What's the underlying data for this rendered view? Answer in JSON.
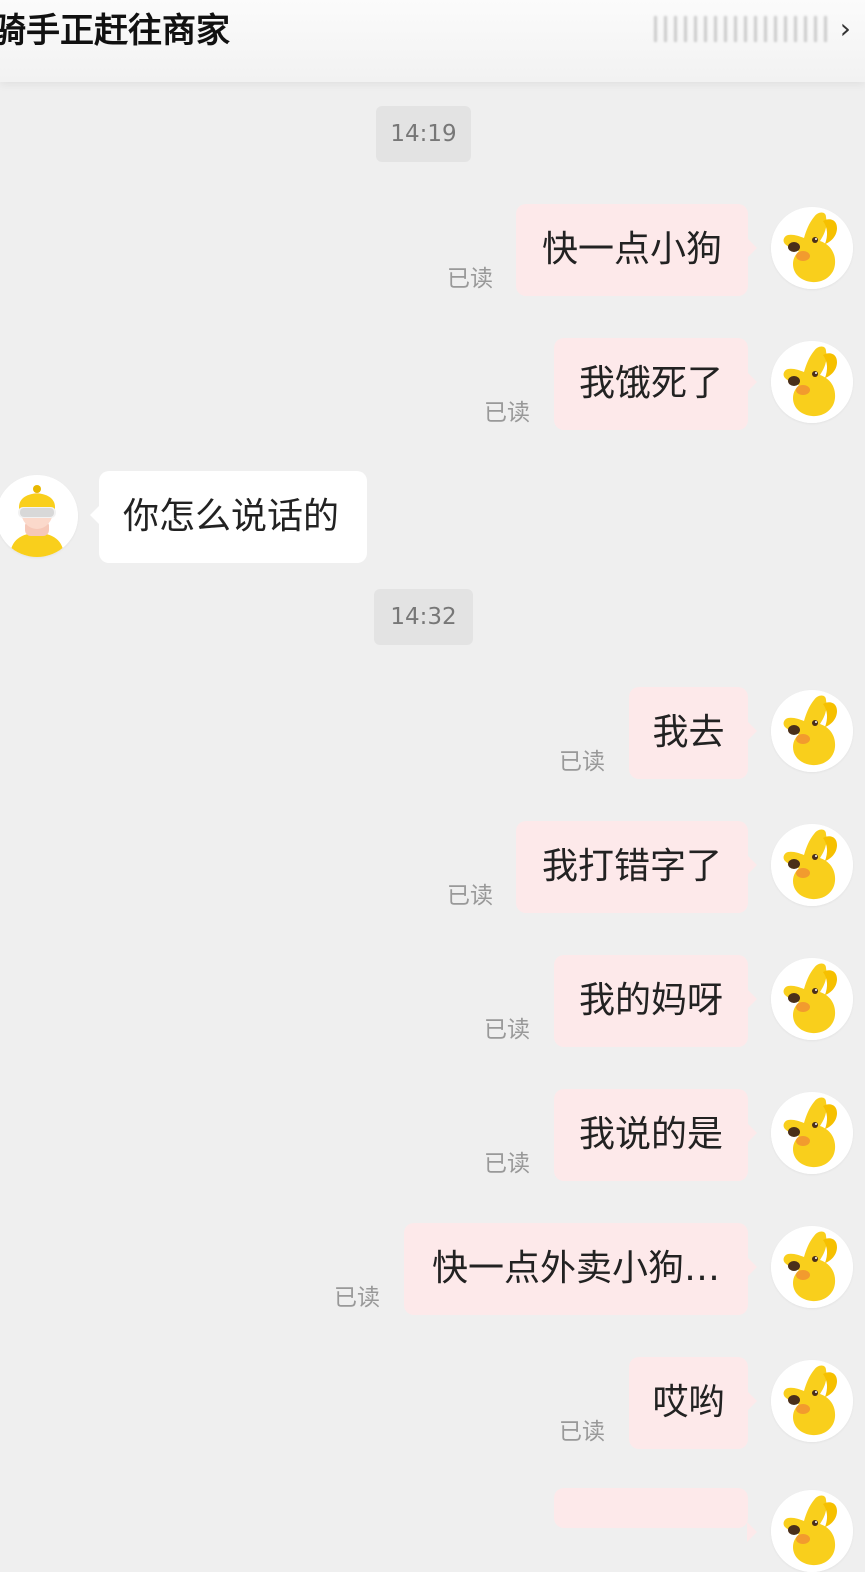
{
  "header": {
    "title": "骑手正赶往商家",
    "right_text": "▒▒▒▒▒▒",
    "chevron": "›"
  },
  "chat": {
    "timestamps": [
      "14:19",
      "14:32"
    ],
    "read_label": "已读",
    "messages": [
      {
        "from": "me",
        "text": "快一点小狗",
        "status": "已读"
      },
      {
        "from": "me",
        "text": "我饿死了",
        "status": "已读"
      },
      {
        "from": "rider",
        "text": "你怎么说话的"
      },
      {
        "from": "me",
        "text": "我去",
        "status": "已读"
      },
      {
        "from": "me",
        "text": "我打错字了",
        "status": "已读"
      },
      {
        "from": "me",
        "text": "我的妈呀",
        "status": "已读"
      },
      {
        "from": "me",
        "text": "我说的是",
        "status": "已读"
      },
      {
        "from": "me",
        "text": "快一点外卖小狗…",
        "status": "已读"
      },
      {
        "from": "me",
        "text": "哎哟",
        "status": "已读"
      }
    ]
  },
  "colors": {
    "my_bubble": "#fde9ea",
    "rider_bubble": "#ffffff",
    "background": "#efefef",
    "avatar_yellow": "#f9cf1c"
  }
}
